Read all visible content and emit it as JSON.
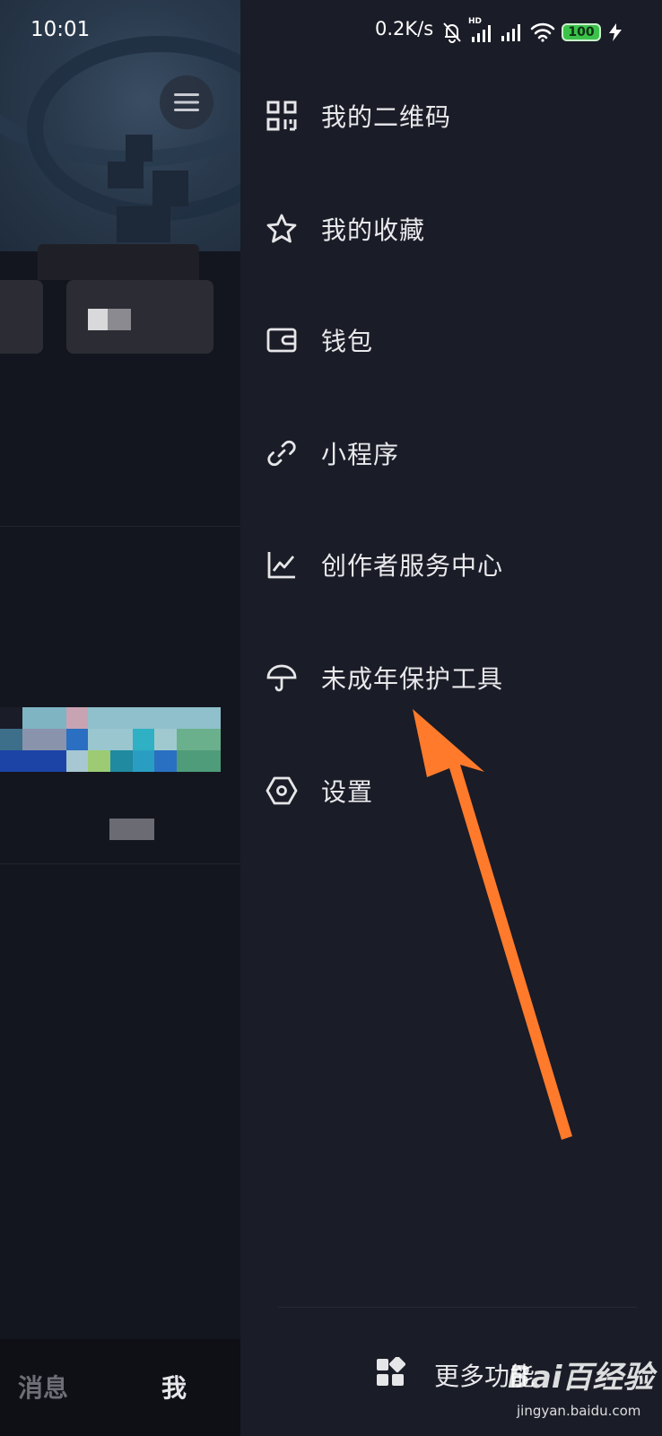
{
  "status_bar": {
    "time": "10:01",
    "net_speed": "0.2K/s",
    "hd_label": "HD",
    "battery": "100",
    "icons": [
      "bell-off-icon",
      "signal-hd-icon",
      "signal-icon",
      "wifi-icon",
      "battery-icon",
      "charging-icon"
    ]
  },
  "drawer": {
    "items": [
      {
        "label": "我的二维码",
        "icon": "qr-code-icon"
      },
      {
        "label": "我的收藏",
        "icon": "star-icon"
      },
      {
        "label": "钱包",
        "icon": "wallet-icon"
      },
      {
        "label": "小程序",
        "icon": "link-icon"
      },
      {
        "label": "创作者服务中心",
        "icon": "line-chart-icon"
      },
      {
        "label": "未成年保护工具",
        "icon": "umbrella-icon"
      },
      {
        "label": "设置",
        "icon": "hexagon-settings-icon"
      }
    ],
    "more_label": "更多功能",
    "more_icon": "apps-grid-icon"
  },
  "background_app": {
    "tabs": [
      "消息",
      "我"
    ]
  },
  "annotation": {
    "arrow_color": "#ff7a2b"
  },
  "watermark": {
    "brand": "Bai百经验",
    "url": "jingyan.baidu.com"
  },
  "colors": {
    "drawer_bg": "#1a1c27",
    "left_bg": "#14161f",
    "text": "#e9e9ec",
    "accent_arrow": "#ff7a2b"
  }
}
